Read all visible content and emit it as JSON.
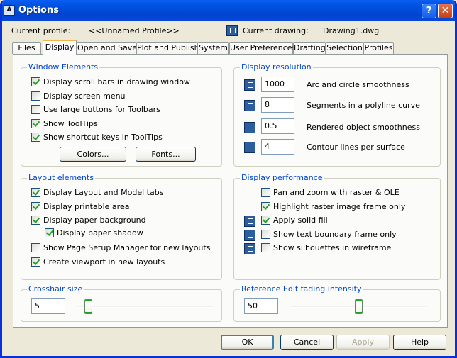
{
  "window": {
    "title": "Options"
  },
  "header": {
    "current_profile_label": "Current profile:",
    "current_profile_value": "<<Unnamed Profile>>",
    "current_drawing_label": "Current drawing:",
    "current_drawing_value": "Drawing1.dwg"
  },
  "tabs": [
    {
      "label": "Files"
    },
    {
      "label": "Display"
    },
    {
      "label": "Open and Save"
    },
    {
      "label": "Plot and Publish"
    },
    {
      "label": "System"
    },
    {
      "label": "User Preferences"
    },
    {
      "label": "Drafting"
    },
    {
      "label": "Selection"
    },
    {
      "label": "Profiles"
    }
  ],
  "active_tab": "Display",
  "window_elements": {
    "title": "Window Elements",
    "items": [
      {
        "label": "Display scroll bars in drawing window",
        "checked": true
      },
      {
        "label": "Display screen menu",
        "checked": false
      },
      {
        "label": "Use large buttons for Toolbars",
        "checked": false
      },
      {
        "label": "Show ToolTips",
        "checked": true
      },
      {
        "label": "Show shortcut keys in ToolTips",
        "checked": true
      }
    ],
    "colors_button": "Colors...",
    "fonts_button": "Fonts..."
  },
  "display_resolution": {
    "title": "Display resolution",
    "items": [
      {
        "value": "1000",
        "label": "Arc and circle smoothness"
      },
      {
        "value": "8",
        "label": "Segments in a polyline curve"
      },
      {
        "value": "0.5",
        "label": "Rendered object smoothness"
      },
      {
        "value": "4",
        "label": "Contour lines per surface"
      }
    ]
  },
  "layout_elements": {
    "title": "Layout elements",
    "items": [
      {
        "label": "Display Layout and Model tabs",
        "checked": true
      },
      {
        "label": "Display printable area",
        "checked": true
      },
      {
        "label": "Display paper background",
        "checked": true
      },
      {
        "label": "Display paper shadow",
        "checked": true
      },
      {
        "label": "Show Page Setup Manager for new layouts",
        "checked": false
      },
      {
        "label": "Create viewport in new layouts",
        "checked": true
      }
    ]
  },
  "display_performance": {
    "title": "Display performance",
    "items": [
      {
        "label": "Pan and zoom with raster & OLE",
        "checked": false
      },
      {
        "label": "Highlight raster image frame only",
        "checked": true
      },
      {
        "label": "Apply solid fill",
        "checked": true
      },
      {
        "label": "Show text boundary frame only",
        "checked": false
      },
      {
        "label": "Show silhouettes in wireframe",
        "checked": false
      }
    ]
  },
  "crosshair": {
    "title": "Crosshair size",
    "value": "5",
    "slider_fraction": 0.05
  },
  "xref_fading": {
    "title": "Reference Edit fading intensity",
    "value": "50",
    "slider_fraction": 0.5
  },
  "footer": {
    "ok": "OK",
    "cancel": "Cancel",
    "apply": "Apply",
    "help": "Help"
  },
  "icons": {
    "app": "autocad-icon",
    "drawing": "drawing-setting-icon"
  }
}
